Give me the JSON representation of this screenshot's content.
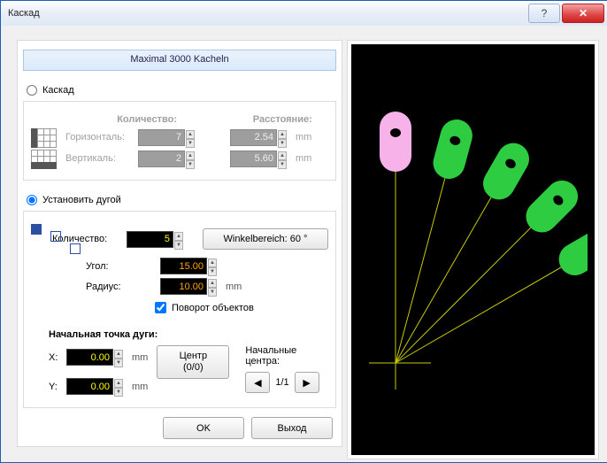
{
  "window": {
    "title": "Каскад"
  },
  "header": {
    "text": "Maximal 3000 Kacheln"
  },
  "mode": {
    "cascade_label": "Каскад",
    "arc_label": "Установить дугой",
    "selected": "arc"
  },
  "cascade": {
    "qty_header": "Количество:",
    "dist_header": "Расстояние:",
    "h_label": "Горизонталь:",
    "v_label": "Вертикаль:",
    "h_qty": "7",
    "v_qty": "2",
    "h_dist": "2.54",
    "v_dist": "5.60",
    "unit": "mm"
  },
  "arc": {
    "qty_label": "Количество:",
    "qty": "5",
    "angle_label": "Угол:",
    "angle": "15.00",
    "radius_label": "Радиус:",
    "radius": "10.00",
    "unit": "mm",
    "range_button": "Winkelbereich: 60 °",
    "rotate_label": "Поворот объектов",
    "rotate_checked": true
  },
  "start": {
    "title": "Начальная точка дуги:",
    "x_label": "X:",
    "y_label": "Y:",
    "x": "0.00",
    "y": "0.00",
    "unit": "mm",
    "center_btn_line1": "Центр",
    "center_btn_line2": "(0/0)",
    "nav_title": "Начальные центра:",
    "nav_pos": "1/1"
  },
  "buttons": {
    "ok": "OK",
    "exit": "Выход"
  },
  "icons": {
    "help": "?",
    "close": "✕",
    "prev": "◀",
    "next": "▶",
    "up": "▲",
    "down": "▼"
  },
  "preview": {
    "count": 5,
    "angle_step_deg": 15,
    "colors": {
      "first": "#f7b2e9",
      "rest": "#2ecc40",
      "dot": "#000",
      "line": "#c8c800"
    }
  }
}
